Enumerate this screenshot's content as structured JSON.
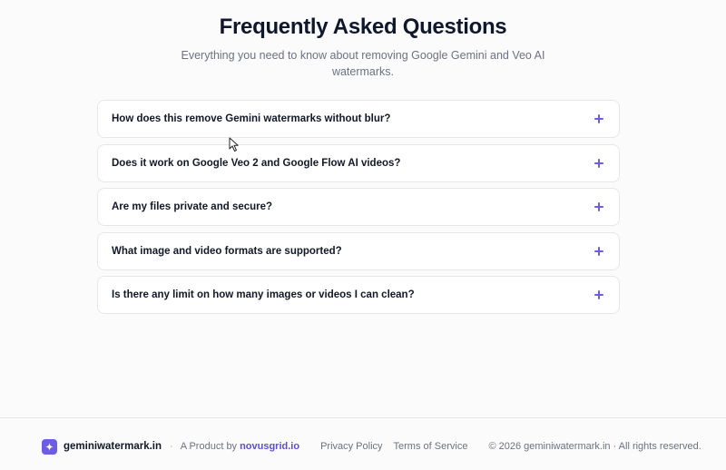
{
  "faq": {
    "title": "Frequently Asked Questions",
    "subtitle": "Everything you need to know about removing Google Gemini and Veo AI watermarks.",
    "items": [
      {
        "question": "How does this remove Gemini watermarks without blur?"
      },
      {
        "question": "Does it work on Google Veo 2 and Google Flow AI videos?"
      },
      {
        "question": "Are my files private and secure?"
      },
      {
        "question": "What image and video formats are supported?"
      },
      {
        "question": "Is there any limit on how many images or videos I can clean?"
      }
    ],
    "expand_icon": "plus-icon"
  },
  "footer": {
    "brand_icon": "sparkle-icon",
    "brand_name": "geminiwatermark.in",
    "separator": "·",
    "product_by": "A Product by",
    "product_link": "novusgrid.io",
    "privacy_link": "Privacy Policy",
    "terms_link": "Terms of Service",
    "copyright": "© 2026 geminiwatermark.in · All rights reserved."
  },
  "colors": {
    "accent": "#6d5ce6",
    "background": "#fbfbfc",
    "card_border": "#e5e7eb",
    "muted_text": "#6b7280"
  }
}
